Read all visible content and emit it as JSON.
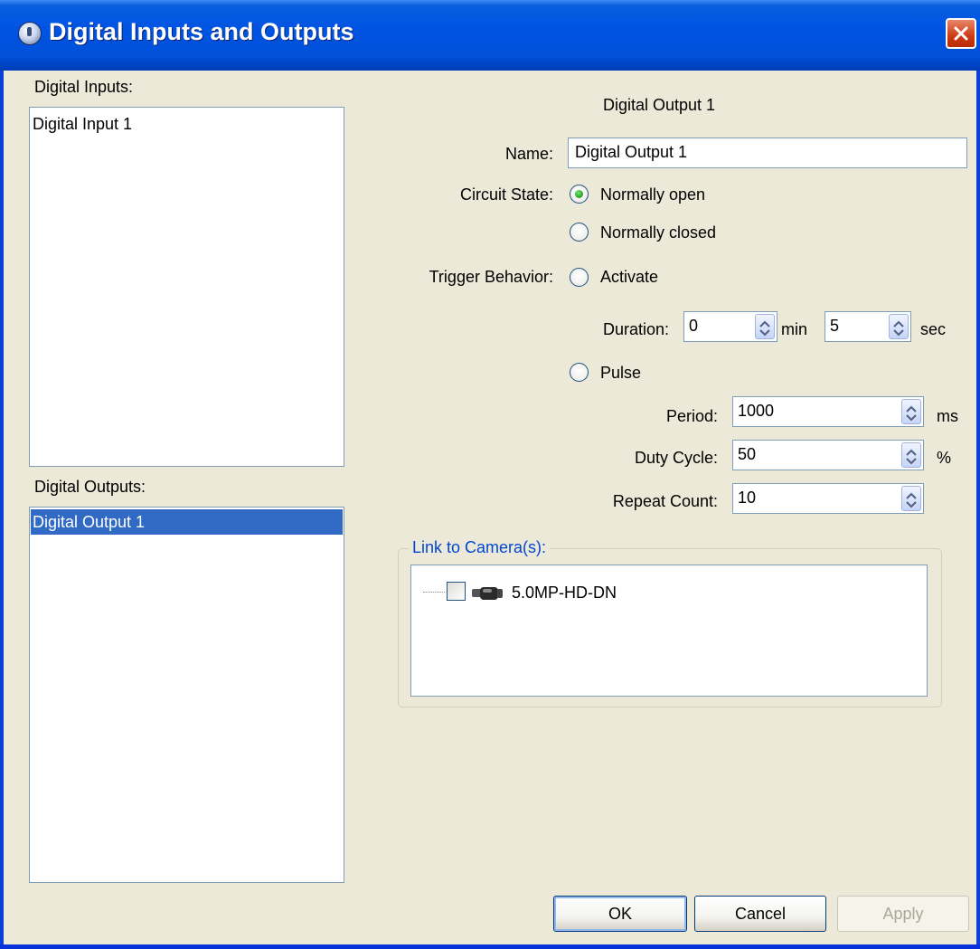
{
  "window": {
    "title": "Digital Inputs and Outputs",
    "title_icon": "app-icon",
    "close_icon": "close-icon"
  },
  "inputs": {
    "label": "Digital Inputs:",
    "items": [
      "Digital Input 1"
    ]
  },
  "outputs": {
    "label": "Digital Outputs:",
    "items": [
      "Digital Output 1"
    ],
    "selected_index": 0
  },
  "detail": {
    "heading": "Digital Output 1",
    "name_label": "Name:",
    "name_value": "Digital Output 1",
    "circuit_state_label": "Circuit State:",
    "circuit_options": [
      "Normally open",
      "Normally closed"
    ],
    "circuit_selected": "Normally open",
    "trigger_label": "Trigger Behavior:",
    "activate_label": "Activate",
    "duration_label": "Duration:",
    "duration_min": "0",
    "min_unit": "min",
    "duration_sec": "5",
    "sec_unit": "sec",
    "pulse_label": "Pulse",
    "period_label": "Period:",
    "period_value": "1000",
    "period_unit": "ms",
    "duty_label": "Duty Cycle:",
    "duty_value": "50",
    "duty_unit": "%",
    "repeat_label": "Repeat Count:",
    "repeat_value": "10"
  },
  "link": {
    "legend": "Link to Camera(s):",
    "cameras": [
      {
        "label": "5.0MP-HD-DN",
        "checked": false,
        "icon": "camera-icon"
      }
    ]
  },
  "buttons": {
    "ok": "OK",
    "cancel": "Cancel",
    "apply": "Apply"
  },
  "colors": {
    "titlebar": "#0054e3",
    "selection": "#316ac5",
    "legend": "#0046d5",
    "dialog_bg": "#ece9d8"
  }
}
